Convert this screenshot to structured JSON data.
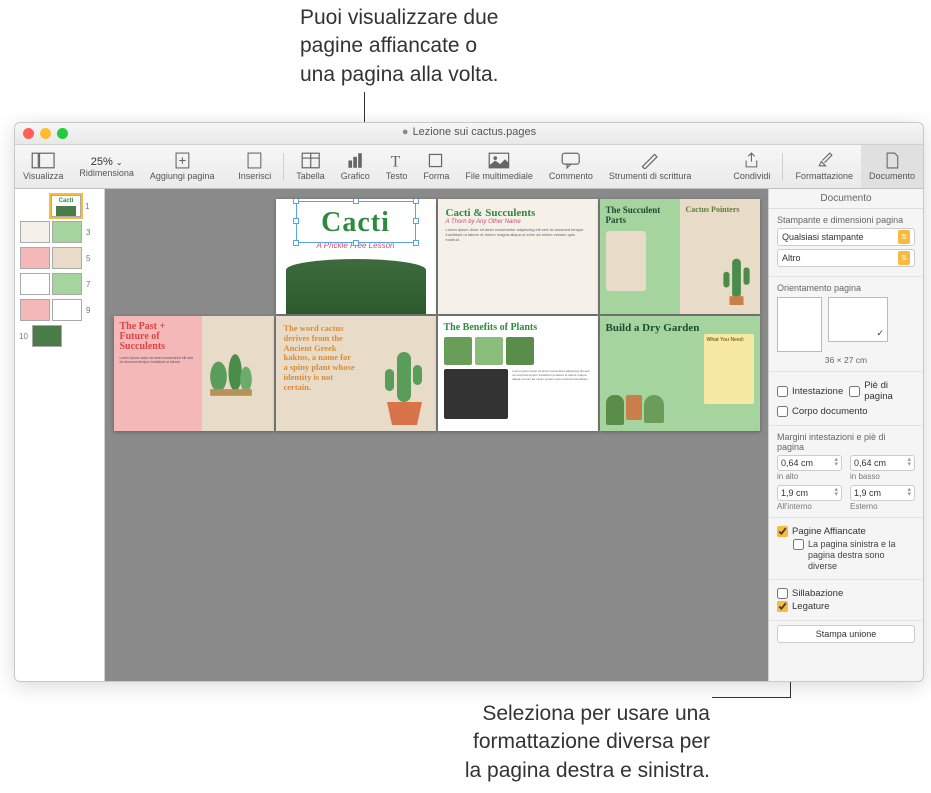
{
  "callouts": {
    "top": "Puoi visualizzare due pagine affiancate o una pagina alla volta.",
    "top_l1": "Puoi visualizzare due",
    "top_l2": "pagine affiancate o",
    "top_l3": "una pagina alla volta.",
    "bottom": "Seleziona per usare una formattazione diversa per la pagina destra e sinistra.",
    "bottom_l1": "Seleziona per usare una",
    "bottom_l2": "formattazione diversa per",
    "bottom_l3": "la pagina destra e sinistra."
  },
  "window": {
    "title": "Lezione sui cactus.pages",
    "modified_dot": "●"
  },
  "toolbar": {
    "view": "Visualizza",
    "zoom": "25%",
    "zoom_label": "Ridimensiona",
    "add_page": "Aggiungi pagina",
    "insert": "Inserisci",
    "table": "Tabella",
    "chart": "Grafico",
    "text": "Testo",
    "shape": "Forma",
    "media": "File multimediale",
    "comment": "Commento",
    "writing": "Strumenti di scrittura",
    "share": "Condividi",
    "format": "Formattazione",
    "document": "Documento"
  },
  "thumbs": {
    "n1": "1",
    "n3": "3",
    "n5": "5",
    "n7": "7",
    "n9": "9",
    "n10": "10"
  },
  "pages": {
    "cover_title": "Cacti",
    "cover_sub": "A Prickle Free Lesson",
    "p2_title": "Cacti & Succulents",
    "p2_sub": "A Thorn by Any Other Name",
    "p3_title1": "The Succulent Parts",
    "p3_title2": "Cactus Pointers",
    "p4_title": "The Past + Future of Succulents",
    "p5_text": "The word cactus derives from the Ancient Greek kaktos, a name for a spiny plant whose identity is not certain.",
    "p6_title": "The Benefits of Plants",
    "p7_title": "Build a Dry Garden",
    "p7_box": "What You Need:"
  },
  "inspector": {
    "head": "Documento",
    "printer_section": "Stampante e dimensioni pagina",
    "printer": "Qualsiasi stampante",
    "paper": "Altro",
    "orientation": "Orientamento pagina",
    "dimensions": "36 × 27 cm",
    "header": "Intestazione",
    "footer": "Piè di pagina",
    "body": "Corpo documento",
    "margins_title": "Margini intestazioni e piè di pagina",
    "m_top": "0,64 cm",
    "m_top_l": "in alto",
    "m_bot": "0,64 cm",
    "m_bot_l": "in basso",
    "m_in": "1,9 cm",
    "m_in_l": "All'interno",
    "m_out": "1,9 cm",
    "m_out_l": "Esterno",
    "facing": "Pagine Affiancate",
    "facing_sub": "La pagina sinistra e la pagina destra sono diverse",
    "hyphen": "Sillabazione",
    "ligatures": "Legature",
    "merge": "Stampa unione"
  }
}
